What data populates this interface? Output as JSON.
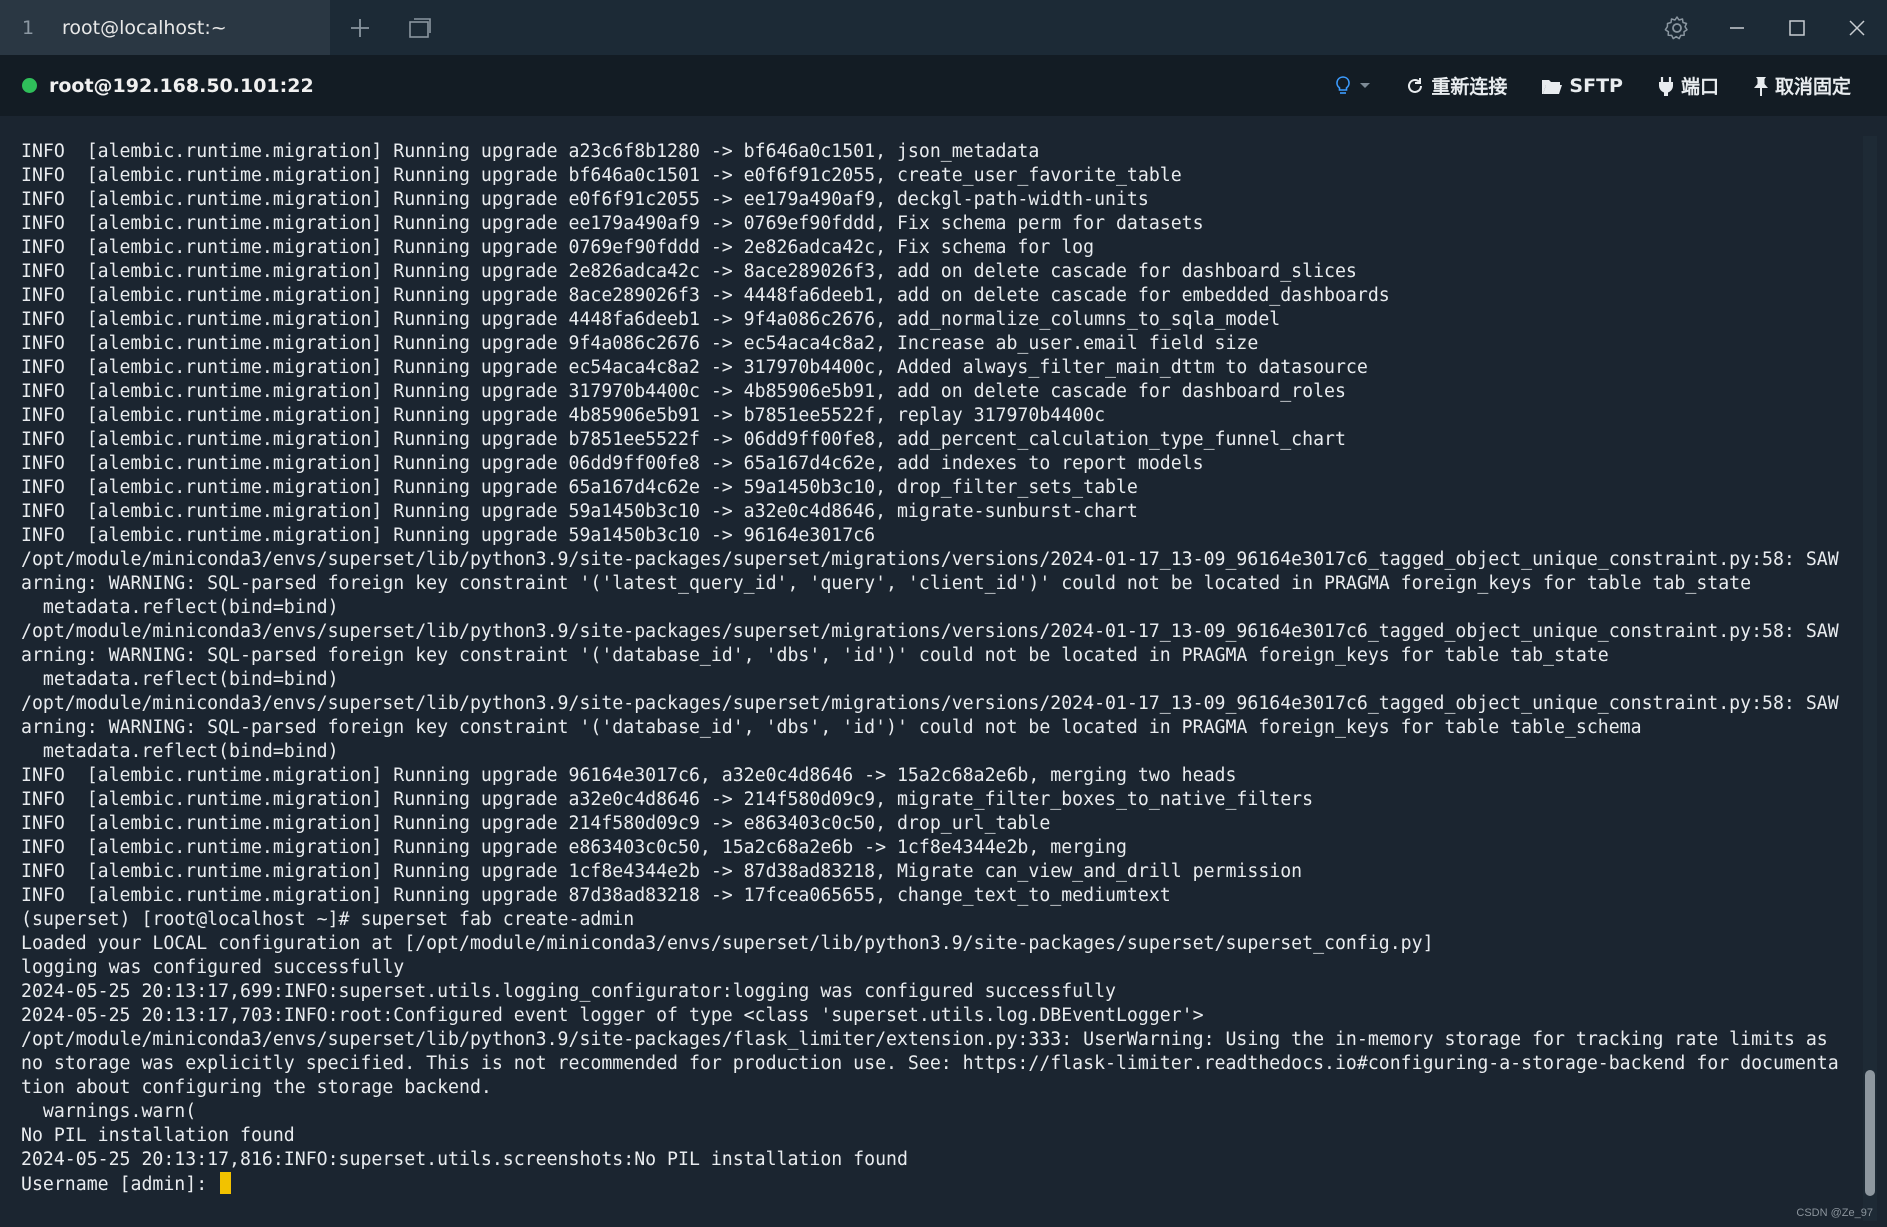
{
  "tab": {
    "index": "1",
    "title": "root@localhost:~"
  },
  "connection": {
    "host": "root@192.168.50.101:22"
  },
  "actions": {
    "reconnect": "重新连接",
    "sftp": "SFTP",
    "port": "端口",
    "unpin": "取消固定"
  },
  "colors": {
    "status_dot": "#2fbf5a",
    "cursor": "#f2c200",
    "background": "#1b2530"
  },
  "terminal": {
    "lines": [
      "INFO  [alembic.runtime.migration] Running upgrade a23c6f8b1280 -> bf646a0c1501, json_metadata",
      "INFO  [alembic.runtime.migration] Running upgrade bf646a0c1501 -> e0f6f91c2055, create_user_favorite_table",
      "INFO  [alembic.runtime.migration] Running upgrade e0f6f91c2055 -> ee179a490af9, deckgl-path-width-units",
      "INFO  [alembic.runtime.migration] Running upgrade ee179a490af9 -> 0769ef90fddd, Fix schema perm for datasets",
      "INFO  [alembic.runtime.migration] Running upgrade 0769ef90fddd -> 2e826adca42c, Fix schema for log",
      "INFO  [alembic.runtime.migration] Running upgrade 2e826adca42c -> 8ace289026f3, add on delete cascade for dashboard_slices",
      "INFO  [alembic.runtime.migration] Running upgrade 8ace289026f3 -> 4448fa6deeb1, add on delete cascade for embedded_dashboards",
      "INFO  [alembic.runtime.migration] Running upgrade 4448fa6deeb1 -> 9f4a086c2676, add_normalize_columns_to_sqla_model",
      "INFO  [alembic.runtime.migration] Running upgrade 9f4a086c2676 -> ec54aca4c8a2, Increase ab_user.email field size",
      "INFO  [alembic.runtime.migration] Running upgrade ec54aca4c8a2 -> 317970b4400c, Added always_filter_main_dttm to datasource",
      "INFO  [alembic.runtime.migration] Running upgrade 317970b4400c -> 4b85906e5b91, add on delete cascade for dashboard_roles",
      "INFO  [alembic.runtime.migration] Running upgrade 4b85906e5b91 -> b7851ee5522f, replay 317970b4400c",
      "INFO  [alembic.runtime.migration] Running upgrade b7851ee5522f -> 06dd9ff00fe8, add_percent_calculation_type_funnel_chart",
      "INFO  [alembic.runtime.migration] Running upgrade 06dd9ff00fe8 -> 65a167d4c62e, add indexes to report models",
      "INFO  [alembic.runtime.migration] Running upgrade 65a167d4c62e -> 59a1450b3c10, drop_filter_sets_table",
      "INFO  [alembic.runtime.migration] Running upgrade 59a1450b3c10 -> a32e0c4d8646, migrate-sunburst-chart",
      "INFO  [alembic.runtime.migration] Running upgrade 59a1450b3c10 -> 96164e3017c6",
      "/opt/module/miniconda3/envs/superset/lib/python3.9/site-packages/superset/migrations/versions/2024-01-17_13-09_96164e3017c6_tagged_object_unique_constraint.py:58: SAW",
      "arning: WARNING: SQL-parsed foreign key constraint '('latest_query_id', 'query', 'client_id')' could not be located in PRAGMA foreign_keys for table tab_state",
      "  metadata.reflect(bind=bind)",
      "/opt/module/miniconda3/envs/superset/lib/python3.9/site-packages/superset/migrations/versions/2024-01-17_13-09_96164e3017c6_tagged_object_unique_constraint.py:58: SAW",
      "arning: WARNING: SQL-parsed foreign key constraint '('database_id', 'dbs', 'id')' could not be located in PRAGMA foreign_keys for table tab_state",
      "  metadata.reflect(bind=bind)",
      "/opt/module/miniconda3/envs/superset/lib/python3.9/site-packages/superset/migrations/versions/2024-01-17_13-09_96164e3017c6_tagged_object_unique_constraint.py:58: SAW",
      "arning: WARNING: SQL-parsed foreign key constraint '('database_id', 'dbs', 'id')' could not be located in PRAGMA foreign_keys for table table_schema",
      "  metadata.reflect(bind=bind)",
      "INFO  [alembic.runtime.migration] Running upgrade 96164e3017c6, a32e0c4d8646 -> 15a2c68a2e6b, merging two heads",
      "INFO  [alembic.runtime.migration] Running upgrade a32e0c4d8646 -> 214f580d09c9, migrate_filter_boxes_to_native_filters",
      "INFO  [alembic.runtime.migration] Running upgrade 214f580d09c9 -> e863403c0c50, drop_url_table",
      "INFO  [alembic.runtime.migration] Running upgrade e863403c0c50, 15a2c68a2e6b -> 1cf8e4344e2b, merging",
      "INFO  [alembic.runtime.migration] Running upgrade 1cf8e4344e2b -> 87d38ad83218, Migrate can_view_and_drill permission",
      "INFO  [alembic.runtime.migration] Running upgrade 87d38ad83218 -> 17fcea065655, change_text_to_mediumtext",
      "(superset) [root@localhost ~]# superset fab create-admin",
      "Loaded your LOCAL configuration at [/opt/module/miniconda3/envs/superset/lib/python3.9/site-packages/superset/superset_config.py]",
      "logging was configured successfully",
      "2024-05-25 20:13:17,699:INFO:superset.utils.logging_configurator:logging was configured successfully",
      "2024-05-25 20:13:17,703:INFO:root:Configured event logger of type <class 'superset.utils.log.DBEventLogger'>",
      "/opt/module/miniconda3/envs/superset/lib/python3.9/site-packages/flask_limiter/extension.py:333: UserWarning: Using the in-memory storage for tracking rate limits as",
      "no storage was explicitly specified. This is not recommended for production use. See: https://flask-limiter.readthedocs.io#configuring-a-storage-backend for documenta",
      "tion about configuring the storage backend.",
      "  warnings.warn(",
      "No PIL installation found",
      "2024-05-25 20:13:17,816:INFO:superset.utils.screenshots:No PIL installation found"
    ],
    "prompt": "Username [admin]: "
  },
  "watermark": "CSDN @Ze_97"
}
